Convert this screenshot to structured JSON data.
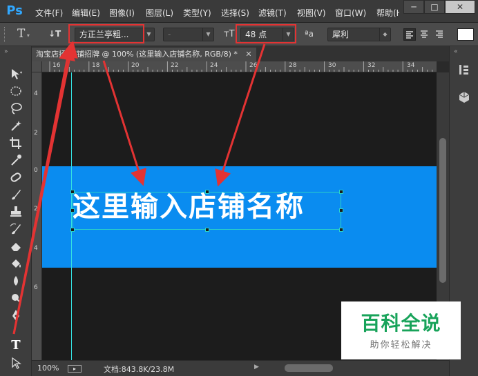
{
  "app": {
    "logo": "Ps"
  },
  "menu": [
    "文件(F)",
    "编辑(E)",
    "图像(I)",
    "图层(L)",
    "类型(Y)",
    "选择(S)",
    "滤镜(T)",
    "视图(V)",
    "窗口(W)",
    "帮助(H)"
  ],
  "window_controls": {
    "minimize": "─",
    "restore": "□",
    "close": "✕"
  },
  "options": {
    "tool_glyph": "T",
    "orientation_glyph": "↓T",
    "font_family": "方正兰亭粗...",
    "font_style": "-",
    "size_glyph": "ᴛT",
    "font_size": "48 点",
    "aa_glyph": "ªa",
    "anti_alias": "犀利"
  },
  "document": {
    "tab_title": "淘宝店招-店铺招牌 @ 100% (这里输入店铺名称, RGB/8) *",
    "ruler_h": [
      "16",
      "18",
      "20",
      "22",
      "24",
      "26",
      "28",
      "30",
      "32",
      "34"
    ],
    "ruler_v": [
      "4",
      "2",
      "0",
      "2",
      "4",
      "6"
    ],
    "canvas_text": "这里输入店铺名称",
    "colors": {
      "banner": "#0a8cf0",
      "canvas_bg": "#1c1c1c",
      "guide": "#34e0e0",
      "highlight": "#e33333"
    }
  },
  "status": {
    "zoom": "100%",
    "doc_info": "文档:843.8K/23.8M"
  },
  "tools": [
    "move-icon",
    "ellipse-marquee-icon",
    "lasso-icon",
    "magic-wand-icon",
    "crop-icon",
    "eyedropper-icon",
    "healing-brush-icon",
    "brush-icon",
    "clone-stamp-icon",
    "history-brush-icon",
    "eraser-icon",
    "paint-bucket-icon",
    "blur-icon",
    "dodge-icon",
    "pen-icon",
    "type-icon",
    "path-select-icon"
  ],
  "watermark": {
    "title": "百科全说",
    "subtitle": "助你轻松解决"
  }
}
